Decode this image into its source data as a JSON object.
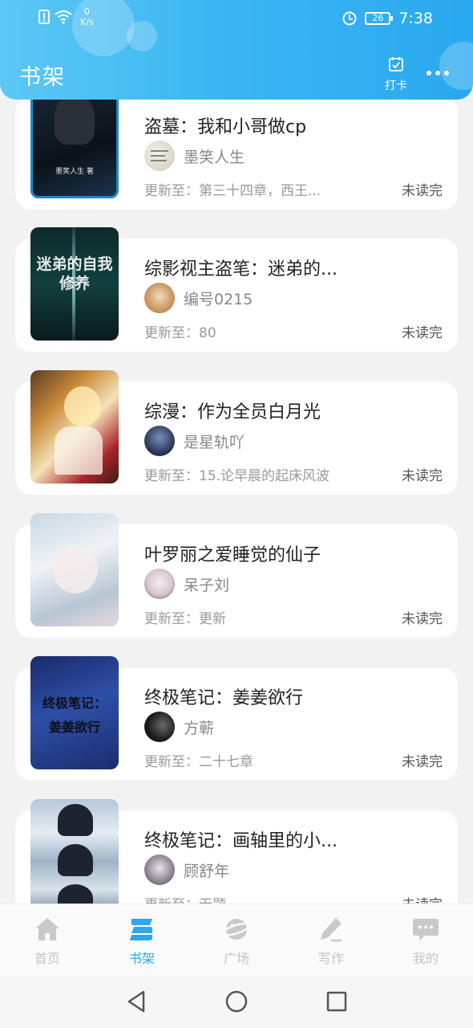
{
  "status_bar": {
    "net_speed": "0",
    "net_unit": "K/s",
    "battery": "26",
    "time": "7:38"
  },
  "header": {
    "title": "书架",
    "checkin_label": "打卡"
  },
  "books": [
    {
      "title": "盗墓：我和小哥做cp",
      "author": "墨笑人生",
      "update": "更新至：第三十四章，西王...",
      "status": "未读完",
      "cover_caption": "墨笑人生 著"
    },
    {
      "title": "综影视主盗笔：迷弟的...",
      "author": "编号0215",
      "update": "更新至：80",
      "status": "未读完",
      "cover_caption": "迷弟的自我修养"
    },
    {
      "title": "综漫：作为全员白月光",
      "author": "是星轨吖",
      "update": "更新至：15.论早晨的起床风波",
      "status": "未读完"
    },
    {
      "title": "叶罗丽之爱睡觉的仙子",
      "author": "呆子刘",
      "update": "更新至：更新",
      "status": "未读完"
    },
    {
      "title": "终极笔记：姜姜欲行",
      "author": "方蕲",
      "update": "更新至：二十七章",
      "status": "未读完",
      "cover_caption": "终极笔记：姜姜欲行"
    },
    {
      "title": "终极笔记：画轴里的小...",
      "author": "顾舒年",
      "update": "更新至：无题",
      "status": "未读完"
    }
  ],
  "bottom_nav": [
    {
      "label": "首页",
      "icon": "home-icon"
    },
    {
      "label": "书架",
      "icon": "bookshelf-icon",
      "active": true
    },
    {
      "label": "广场",
      "icon": "planet-icon"
    },
    {
      "label": "写作",
      "icon": "pen-icon"
    },
    {
      "label": "我的",
      "icon": "chat-bubble-icon"
    }
  ],
  "colors": {
    "header_start": "#5cc8f5",
    "header_end": "#2aa8f0",
    "active_nav": "#2aa8f0",
    "inactive_nav": "#c4c4c4"
  }
}
